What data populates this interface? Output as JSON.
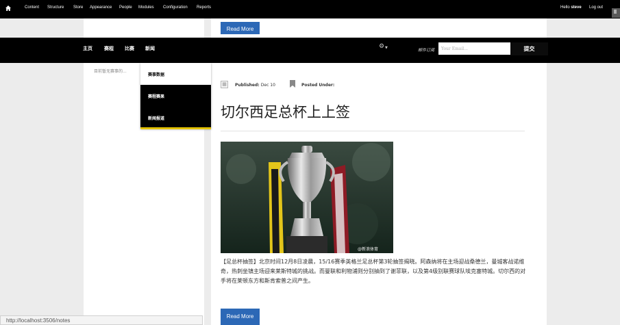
{
  "admin_bar": {
    "items": [
      "Content",
      "Structure",
      "Store",
      "Appearance",
      "People",
      "Modules",
      "Configuration",
      "Reports"
    ],
    "greeting_prefix": "Hello ",
    "username": "steve",
    "logout": "Log out"
  },
  "buttons": {
    "read_more_top": "Read More",
    "read_more_bottom": "Read More"
  },
  "nav": {
    "items": [
      "主页",
      "赛程",
      "比赛",
      "新闻"
    ],
    "subscribe_label": "邮件订阅",
    "email_placeholder": "Your Email...",
    "submit": "提交"
  },
  "dropdown": {
    "items": [
      "赛事数据",
      "赛程赛果",
      "新闻报道"
    ]
  },
  "sidebar": {
    "text": "目前暂无赛事的..."
  },
  "article": {
    "published_label": "Published:",
    "published_date": "Dec 10",
    "posted_label": "Posted Under:",
    "title": "切尔西足总杯上上签",
    "photo_watermark": "@新浪体育",
    "body": "【足总杯抽签】北京时间12月8日凌晨，15/16赛季英格兰足总杯第3轮抽签揭晓。阿森纳将在主场迎战桑德兰，曼城客战诺维奇，热刺坐镇主场迎来莱斯特城的挑战。而曼联和利物浦则分别抽到了谢菲联，以及第4级别联赛球队埃克塞特城。切尔西的对手将在莱顿东方和斯肯索普之间产生。"
  },
  "status_bar": {
    "url": "http://localhost:3506/notes"
  },
  "colors": {
    "accent_blue": "#2c68b6",
    "dropdown_underline": "#e2c100",
    "nav_bg": "#000000"
  }
}
